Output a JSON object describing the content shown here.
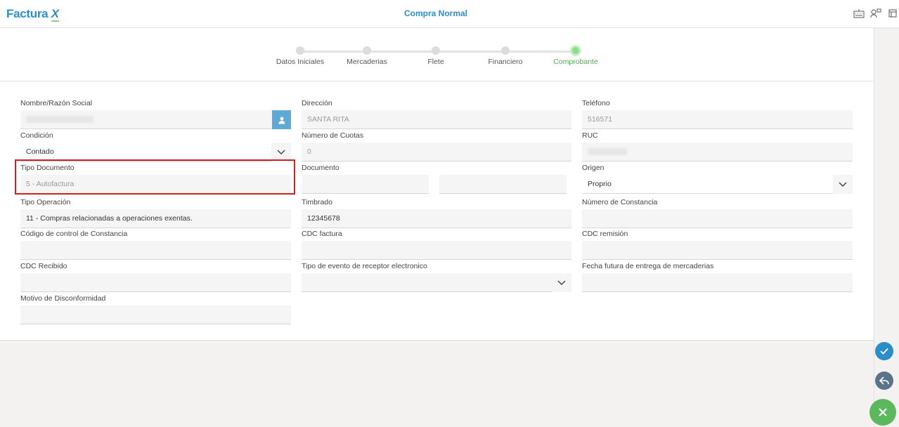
{
  "app": {
    "logo_text": "Factura",
    "logo_x": "X",
    "page_title": "Compra Normal"
  },
  "toolbar": {
    "icons": [
      "keyboard-icon",
      "users-icon",
      "window-icon"
    ]
  },
  "steps": [
    {
      "label": "Datos Iniciales",
      "active": false
    },
    {
      "label": "Mercaderias",
      "active": false
    },
    {
      "label": "Flete",
      "active": false
    },
    {
      "label": "Financiero",
      "active": false
    },
    {
      "label": "Comprobante",
      "active": true
    }
  ],
  "form": {
    "nombre": {
      "label": "Nombre/Razón Social",
      "value": ""
    },
    "direccion": {
      "label": "Dirección",
      "value": "SANTA RITA"
    },
    "telefono": {
      "label": "Teléfono",
      "value": "516571"
    },
    "condicion": {
      "label": "Condición",
      "value": "Contado"
    },
    "cuotas": {
      "label": "Número de Cuotas",
      "value": "0"
    },
    "ruc": {
      "label": "RUC",
      "value": ""
    },
    "tipo_documento": {
      "label": "Tipo Documento",
      "value": "5 - Autofactura"
    },
    "documento": {
      "label": "Documento",
      "value_a": "",
      "value_b": ""
    },
    "origen": {
      "label": "Origen",
      "value": "Proprio"
    },
    "tipo_operacion": {
      "label": "Tipo Operación",
      "value": "11 - Compras relacionadas a operaciones exentas."
    },
    "timbrado": {
      "label": "Timbrado",
      "value": "12345678"
    },
    "nro_constancia": {
      "label": "Número de Constancia",
      "value": ""
    },
    "cod_constancia": {
      "label": "Código de control de Constancia",
      "value": ""
    },
    "cdc_factura": {
      "label": "CDC factura",
      "value": ""
    },
    "cdc_remision": {
      "label": "CDC remisión",
      "value": ""
    },
    "cdc_recibido": {
      "label": "CDC Recibido",
      "value": ""
    },
    "tipo_evento": {
      "label": "Tipo de evento de receptor electronico",
      "value": ""
    },
    "fecha_futura": {
      "label": "Fecha futura de entrega de mercaderias",
      "value": ""
    },
    "motivo": {
      "label": "Motivo de Disconformidad",
      "value": ""
    }
  },
  "actions": {
    "confirm_color": "#2a8fc9",
    "back_color": "#5a7388",
    "close_color": "#5cb85c"
  }
}
